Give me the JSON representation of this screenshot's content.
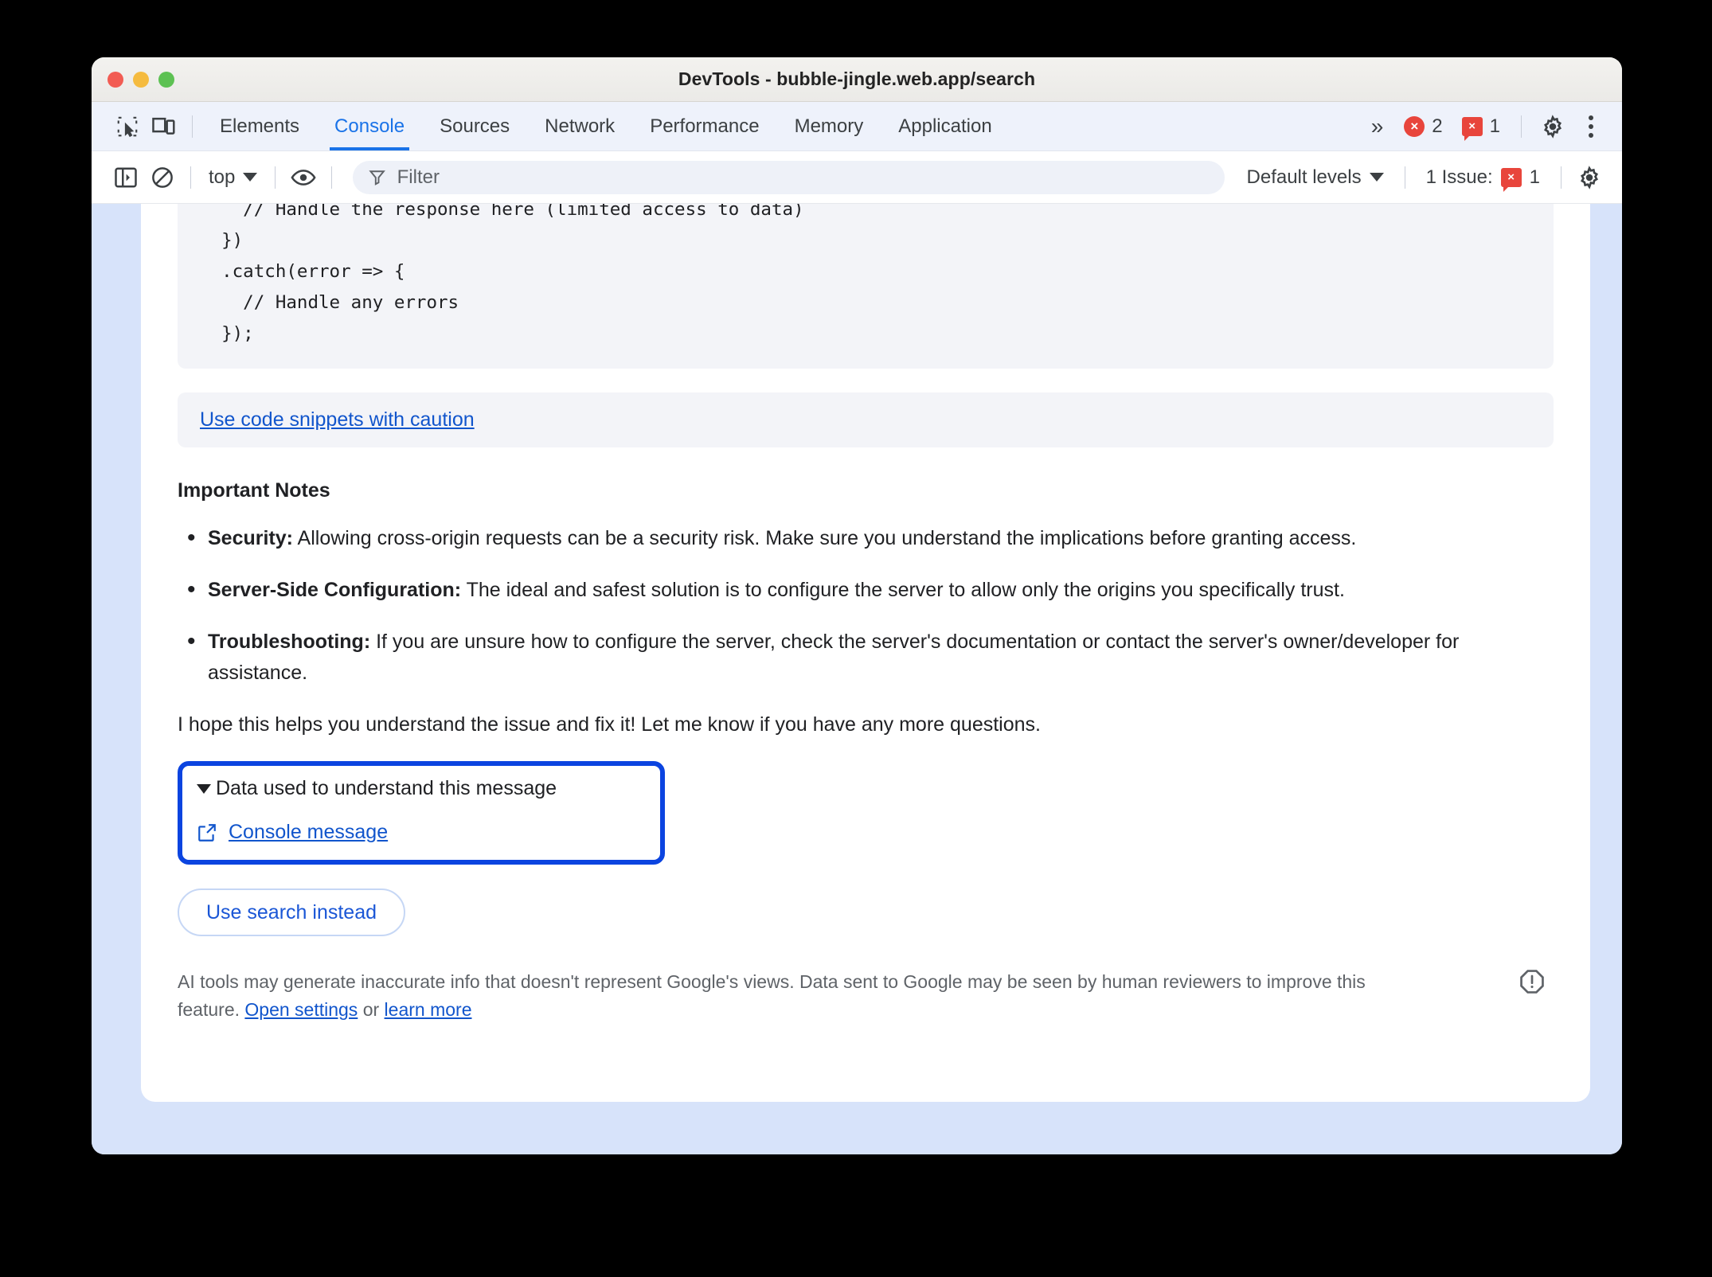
{
  "window": {
    "title": "DevTools - bubble-jingle.web.app/search",
    "traffic_lights": [
      "close",
      "minimize",
      "zoom"
    ]
  },
  "tabbar": {
    "inspect_icon": "inspect-element-icon",
    "device_icon": "device-toolbar-icon",
    "tabs": [
      {
        "label": "Elements",
        "active": false
      },
      {
        "label": "Console",
        "active": true
      },
      {
        "label": "Sources",
        "active": false
      },
      {
        "label": "Network",
        "active": false
      },
      {
        "label": "Performance",
        "active": false
      },
      {
        "label": "Memory",
        "active": false
      },
      {
        "label": "Application",
        "active": false
      }
    ],
    "more_tabs": "»",
    "error_count": "2",
    "issue_count": "1",
    "issue_badge_glyph": "×",
    "error_badge_glyph": "×",
    "settings_icon": "gear-icon",
    "menu_icon": "kebab-menu-icon"
  },
  "consolebar": {
    "sidebar_toggle_icon": "console-sidebar-icon",
    "clear_icon": "clear-console-icon",
    "context": "top",
    "eye_icon": "live-expression-icon",
    "filter_placeholder": "Filter",
    "filter_value": "",
    "filter_icon": "funnel-icon",
    "levels": "Default levels",
    "issues_label": "1 Issue:",
    "issues_count": "1",
    "settings_icon": "gear-icon"
  },
  "message": {
    "code": "    // Handle the response here (limited access to data)\n  })\n  .catch(error => {\n    // Handle any errors\n  });",
    "caution_link": "Use code snippets with caution",
    "notes_title": "Important Notes",
    "notes": [
      {
        "term": "Security:",
        "text": " Allowing cross-origin requests can be a security risk. Make sure you understand the implications before granting access."
      },
      {
        "term": "Server-Side Configuration:",
        "text": " The ideal and safest solution is to configure the server to allow only the origins you specifically trust."
      },
      {
        "term": "Troubleshooting:",
        "text": " If you are unsure how to configure the server, check the server's documentation or contact the server's owner/developer for assistance."
      }
    ],
    "closing": "I hope this helps you understand the issue and fix it! Let me know if you have any more questions.",
    "data_box": {
      "toggle_label": "Data used to understand this message",
      "expanded": true,
      "link_icon": "external-link-icon",
      "link_label": "Console message",
      "highlight_color": "#0b44e0"
    },
    "use_search_button": "Use search instead",
    "disclaimer": {
      "part1": "AI tools may generate inaccurate info that doesn't represent Google's views. Data sent to Google may be seen by human reviewers to improve this feature. ",
      "link1": "Open settings",
      "between": " or ",
      "link2": "learn more",
      "warn_icon": "warning-octagon-icon"
    }
  },
  "colors": {
    "accent": "#1a73e8",
    "link": "#1155cc",
    "error": "#e8453c",
    "panel_blue": "#d7e3fa",
    "tabbar_bg": "#eef2fb"
  }
}
